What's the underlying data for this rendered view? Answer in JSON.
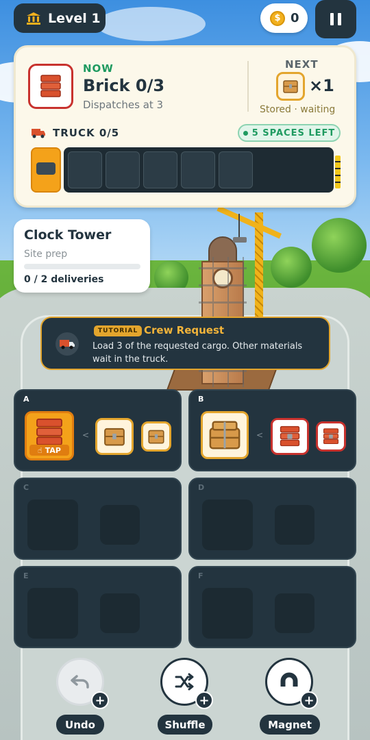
{
  "hud": {
    "level_label": "Level 1",
    "coins": "0"
  },
  "order": {
    "now_label": "NOW",
    "now_title": "Brick 0/3",
    "now_subtitle": "Dispatches at 3",
    "next_label": "NEXT",
    "next_count": "×1",
    "next_status": "Stored · waiting",
    "truck_label": "TRUCK  0/5",
    "spaces_left": "5 SPACES LEFT",
    "truck_slots": [
      "",
      "",
      "",
      "",
      ""
    ]
  },
  "project": {
    "name": "Clock Tower",
    "stage": "Site prep",
    "progress_text": "0 / 2 deliveries",
    "progress_fraction": 0
  },
  "tutorial": {
    "badge": "TUTORIAL",
    "title": "Crew Request",
    "text": "Load 3 of the requested cargo. Other materials wait in the truck."
  },
  "shelves": {
    "a": {
      "label": "A",
      "tap_label": "TAP"
    },
    "b": {
      "label": "B"
    },
    "c": {
      "label": "C"
    },
    "d": {
      "label": "D"
    },
    "e": {
      "label": "E"
    },
    "f": {
      "label": "F"
    },
    "separator": "<"
  },
  "tools": {
    "undo": "Undo",
    "shuffle": "Shuffle",
    "magnet": "Magnet"
  },
  "icons": {
    "level": "bank-icon",
    "coin": "coin-icon",
    "pause": "pause-icon",
    "brick": "brick-stack-icon",
    "crate": "crate-icon",
    "truck": "truck-icon",
    "undo": "undo-icon",
    "shuffle": "shuffle-icon",
    "magnet": "magnet-icon"
  },
  "colors": {
    "dark": "#23343f",
    "accent_orange": "#e3a52d",
    "green": "#1e9a60",
    "brick_red": "#c8322e"
  }
}
